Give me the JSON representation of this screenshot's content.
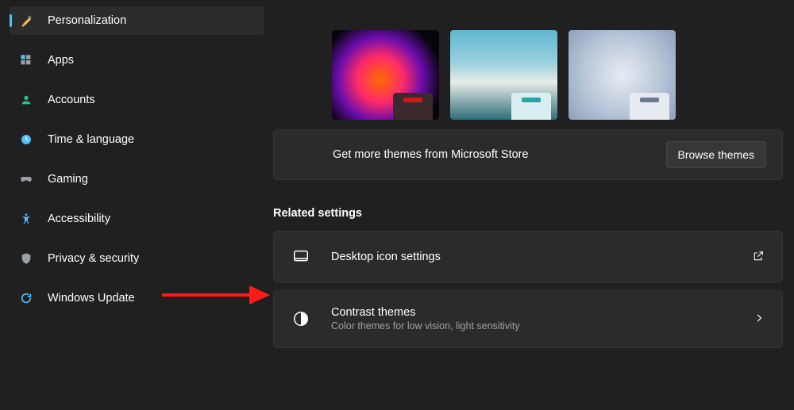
{
  "sidebar": [
    {
      "id": "personalization",
      "label": "Personalization",
      "selected": true
    },
    {
      "id": "apps",
      "label": "Apps"
    },
    {
      "id": "accounts",
      "label": "Accounts"
    },
    {
      "id": "time-language",
      "label": "Time & language"
    },
    {
      "id": "gaming",
      "label": "Gaming"
    },
    {
      "id": "accessibility",
      "label": "Accessibility"
    },
    {
      "id": "privacy",
      "label": "Privacy & security"
    },
    {
      "id": "windows-update",
      "label": "Windows Update"
    }
  ],
  "themes": {
    "top_cut": [
      {
        "mini_bg": "#d9e8f7",
        "bar": "#2b7cff"
      },
      {
        "mini_bg": "#0a2a66",
        "bar": "#1d86ff"
      },
      {
        "mini_bg": "#6b0f4c",
        "bar": "#ff1a8a"
      }
    ],
    "row": [
      {
        "mini_bg": "#3a2a2c",
        "bar": "#d11717"
      },
      {
        "mini_bg": "#d8eef0",
        "bar": "#2aa3a3"
      },
      {
        "mini_bg": "#e6ebf2",
        "bar": "#6c7a93"
      }
    ]
  },
  "store": {
    "text": "Get more themes from Microsoft Store",
    "button": "Browse themes"
  },
  "section_title": "Related settings",
  "rows": {
    "desktop_icons": {
      "title": "Desktop icon settings"
    },
    "contrast": {
      "title": "Contrast themes",
      "subtitle": "Color themes for low vision, light sensitivity"
    }
  }
}
